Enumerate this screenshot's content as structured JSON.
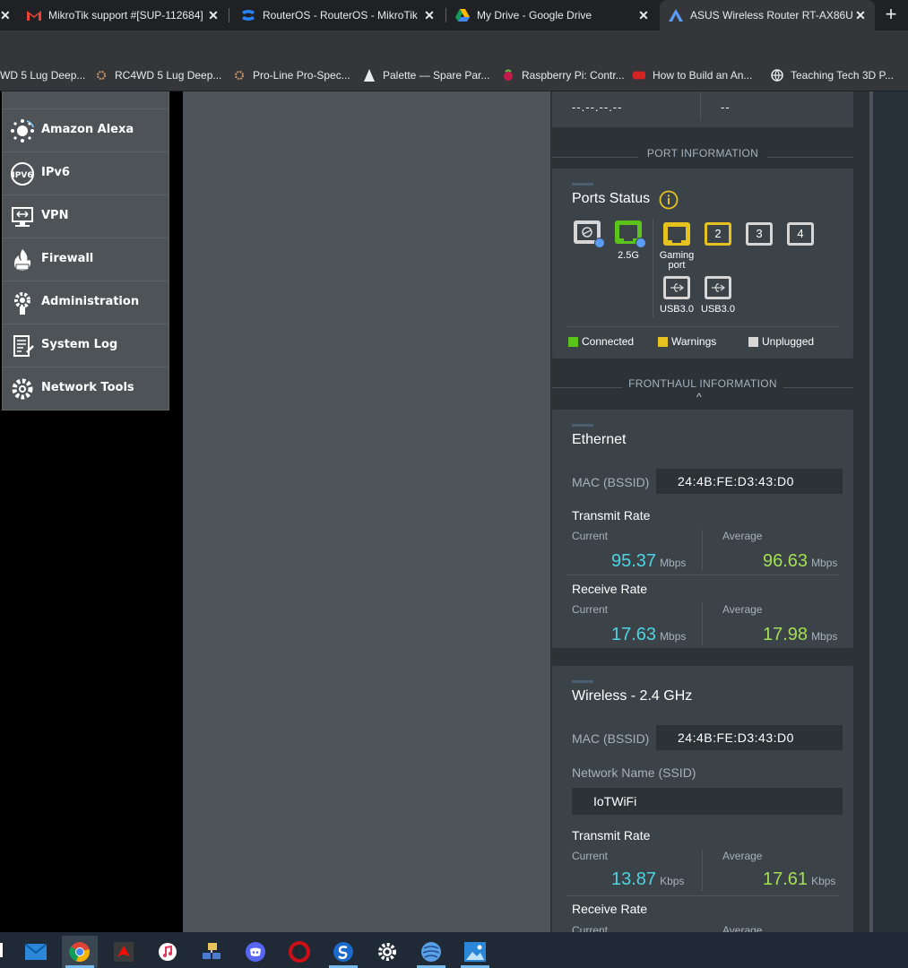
{
  "browser": {
    "tabs": [
      {
        "label": "MikroTik support #[SUP-112684]",
        "icon": "gmail-icon",
        "active": false
      },
      {
        "label": "RouterOS - RouterOS - MikroTik",
        "icon": "confluence-icon",
        "active": false
      },
      {
        "label": "My Drive - Google Drive",
        "icon": "google-drive-icon",
        "active": false
      },
      {
        "label": "ASUS Wireless Router RT-AX86U",
        "icon": "asus-icon",
        "active": true
      }
    ],
    "bookmarks": [
      {
        "label": "WD 5 Lug Deep..."
      },
      {
        "label": "RC4WD 5 Lug Deep..."
      },
      {
        "label": "Pro-Line Pro-Spec..."
      },
      {
        "label": "Palette — Spare Par..."
      },
      {
        "label": "Raspberry Pi: Contr..."
      },
      {
        "label": "How to Build an An..."
      },
      {
        "label": "Teaching Tech 3D P..."
      }
    ]
  },
  "sidebar": {
    "items": [
      {
        "label": "Amazon Alexa",
        "icon": "alexa-icon"
      },
      {
        "label": "IPv6",
        "icon": "ipv6-icon"
      },
      {
        "label": "VPN",
        "icon": "vpn-icon"
      },
      {
        "label": "Firewall",
        "icon": "firewall-icon"
      },
      {
        "label": "Administration",
        "icon": "administration-icon"
      },
      {
        "label": "System Log",
        "icon": "system-log-icon"
      },
      {
        "label": "Network Tools",
        "icon": "network-tools-icon"
      }
    ]
  },
  "top_card": {
    "left_value": "--.--.--.--",
    "right_value": "--"
  },
  "port_info": {
    "header": "PORT INFORMATION",
    "title": "Ports Status",
    "wan_speed": "2.5G",
    "gaming_label": "Gaming port",
    "lan_ports": [
      "2",
      "3",
      "4"
    ],
    "usb_ports": [
      "USB3.0",
      "USB3.0"
    ],
    "legend": {
      "connected": "Connected",
      "warnings": "Warnings",
      "unplugged": "Unplugged"
    },
    "colors": {
      "connected": "#5cc31a",
      "warnings": "#e6c21e",
      "unplugged": "#d6d6d6"
    }
  },
  "fronthaul": {
    "header": "FRONTHAUL INFORMATION",
    "ethernet": {
      "title": "Ethernet",
      "mac_label": "MAC (BSSID)",
      "mac": "24:4B:FE:D3:43:D0",
      "tx_title": "Transmit Rate",
      "tx_current": "95.37",
      "tx_current_unit": "Mbps",
      "tx_average": "96.63",
      "tx_average_unit": "Mbps",
      "rx_title": "Receive Rate",
      "rx_current": "17.63",
      "rx_current_unit": "Mbps",
      "rx_average": "17.98",
      "rx_average_unit": "Mbps",
      "current_label": "Current",
      "average_label": "Average"
    },
    "wireless": {
      "title": "Wireless - 2.4 GHz",
      "mac_label": "MAC (BSSID)",
      "mac": "24:4B:FE:D3:43:D0",
      "ssid_label": "Network Name (SSID)",
      "ssid": "IoTWiFi",
      "tx_title": "Transmit Rate",
      "tx_current": "13.87",
      "tx_current_unit": "Kbps",
      "tx_average": "17.61",
      "tx_average_unit": "Kbps",
      "rx_title": "Receive Rate",
      "current_label": "Current",
      "average_label": "Average"
    }
  },
  "taskbar": {
    "icons": [
      "mail-icon",
      "chrome-icon",
      "acrobat-icon",
      "itunes-icon",
      "network-app-icon",
      "discord-icon",
      "opera-icon",
      "app-s-icon",
      "settings-icon",
      "globe-app-icon",
      "photos-icon"
    ]
  }
}
